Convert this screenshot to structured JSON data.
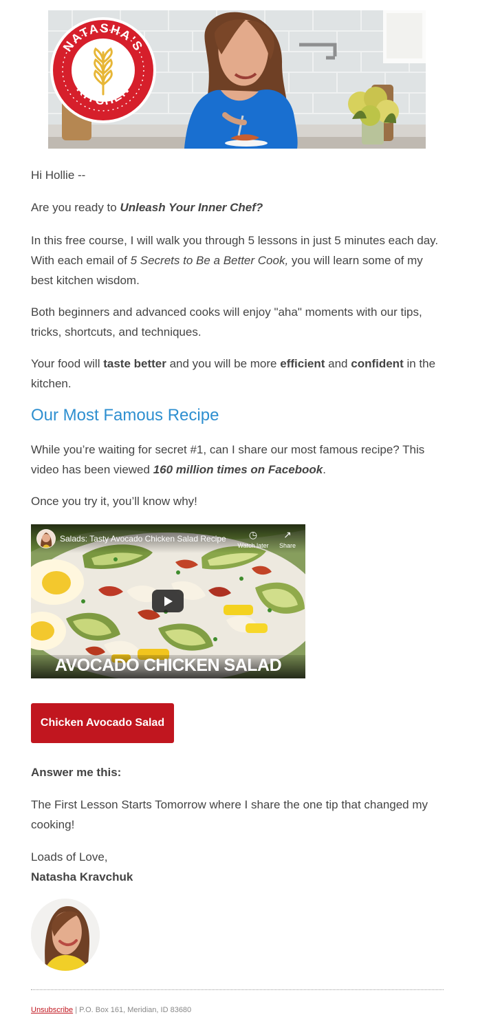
{
  "header": {
    "logo_top": "NATASHA'S",
    "logo_bottom": "KITCHEN"
  },
  "email": {
    "greeting": "Hi Hollie --",
    "intro_prefix": "Are you ready to ",
    "intro_emphasis": "Unleash Your Inner Chef?",
    "course_prefix": "In this free course, I will walk you through 5 lessons in just 5 minutes each day. With each email of ",
    "course_emphasis": "5 Secrets to Be a Better Cook,",
    "course_suffix": " you will learn some of my best kitchen wisdom.",
    "levels": "Both beginners and advanced cooks will enjoy \"aha\" moments with our tips, tricks, shortcuts, and techniques.",
    "benefits_1": "Your food will ",
    "benefits_taste": "taste better",
    "benefits_2": " and you will be more ",
    "benefits_efficient": "efficient",
    "benefits_3": " and ",
    "benefits_confident": "confident",
    "benefits_4": " in the kitchen.",
    "recipe_heading": "Our Most Famous Recipe",
    "waiting_prefix": "While you’re waiting for secret #1, can I share our most famous recipe? This video has been viewed ",
    "waiting_emphasis": "160 million times on Facebook",
    "waiting_suffix": ".",
    "try_text": "Once you try it, you’ll know why!",
    "answer_label": "Answer me this:",
    "lesson_text": "The First Lesson Starts Tomorrow where I share the one tip that changed my cooking!",
    "closing": "Loads of Love,",
    "signature": "Natasha Kravchuk"
  },
  "video": {
    "title": "Salads: Tasty Avocado Chicken Salad Recipe",
    "watch_later": "Watch later",
    "share": "Share",
    "caption": "AVOCADO CHICKEN SALAD",
    "colors": {
      "avocado": "#6d8b3a",
      "egg": "#f3c82d",
      "bacon": "#bd3a26"
    }
  },
  "cta": {
    "label": "Chicken Avocado Salad",
    "color": "#c1161f"
  },
  "footer": {
    "unsubscribe": "Unsubscribe",
    "address": " | P.O. Box 161, Meridian, ID 83680"
  },
  "theme": {
    "accent": "#2e8fd0",
    "brand_red": "#c1161f"
  }
}
